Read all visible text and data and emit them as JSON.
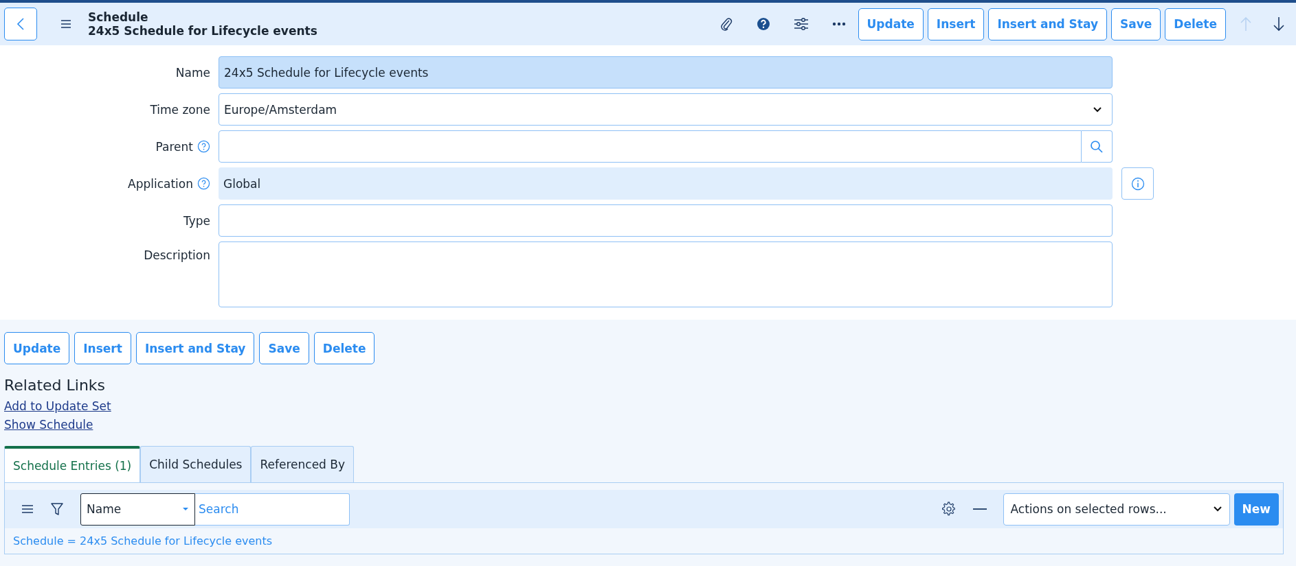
{
  "header": {
    "title": "Schedule",
    "subtitle": "24x5 Schedule for Lifecycle events",
    "buttons": [
      "Update",
      "Insert",
      "Insert and Stay",
      "Save",
      "Delete"
    ],
    "nav": [
      {
        "kind": "up",
        "disabled": true
      },
      {
        "kind": "down",
        "disabled": false
      }
    ]
  },
  "form": {
    "fields": [
      {
        "label": "Name",
        "kind": "text",
        "value": "24x5 Schedule for Lifecycle events",
        "highlighted": true,
        "help": false
      },
      {
        "label": "Time zone",
        "kind": "select",
        "value": "Europe/Amsterdam",
        "help": false
      },
      {
        "label": "Parent",
        "kind": "reference",
        "help": true
      },
      {
        "label": "Application",
        "kind": "readonly",
        "value": "Global",
        "help": true,
        "info": true
      },
      {
        "label": "Type",
        "kind": "text",
        "highlighted": false,
        "help": false
      },
      {
        "label": "Description",
        "kind": "textarea",
        "help": false
      }
    ]
  },
  "buttons": [
    "Update",
    "Insert",
    "Insert and Stay",
    "Save",
    "Delete"
  ],
  "related_links": {
    "title": "Related Links",
    "links": [
      "Add to Update Set",
      "Show Schedule"
    ]
  },
  "tabs": [
    {
      "label": "Schedule Entries (1)",
      "selected": true
    },
    {
      "label": "Child Schedules",
      "selected": false
    },
    {
      "label": "Referenced By",
      "selected": false
    }
  ],
  "list": {
    "search_field": {
      "value": "Name",
      "placeholder": "Search"
    },
    "actions": "Actions on selected rows...",
    "new_button": "New",
    "filter": "Schedule = 24x5 Schedule for Lifecycle events"
  }
}
